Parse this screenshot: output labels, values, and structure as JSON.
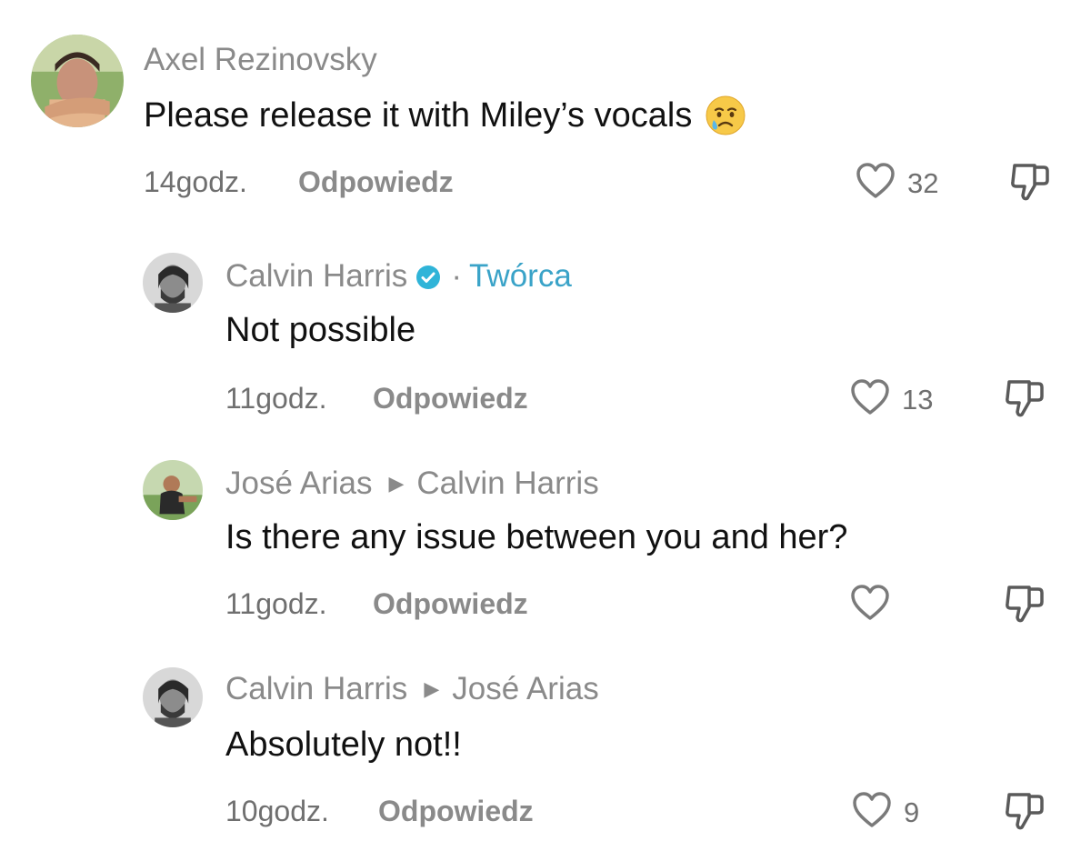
{
  "comments": [
    {
      "author": "Axel Rezinovsky",
      "text": "Please release it with Miley’s vocals",
      "emoji": "crying-face",
      "time": "14godz.",
      "reply_label": "Odpowiedz",
      "likes": "32"
    },
    {
      "author": "Calvin Harris",
      "verified": true,
      "dot": "·",
      "creator_label": "Twórca",
      "text": "Not possible",
      "time": "11godz.",
      "reply_label": "Odpowiedz",
      "likes": "13"
    },
    {
      "author": "José Arias",
      "reply_to": "Calvin Harris",
      "text": "Is there any issue between you and her?",
      "time": "11godz.",
      "reply_label": "Odpowiedz",
      "likes": ""
    },
    {
      "author": "Calvin Harris",
      "reply_to": "José Arias",
      "text": "Absolutely not!!",
      "time": "10godz.",
      "reply_label": "Odpowiedz",
      "likes": "9"
    }
  ],
  "colors": {
    "creator": "#3aa3c8",
    "verified_badge": "#2fb4d8",
    "muted_text": "#8a8a8a"
  }
}
